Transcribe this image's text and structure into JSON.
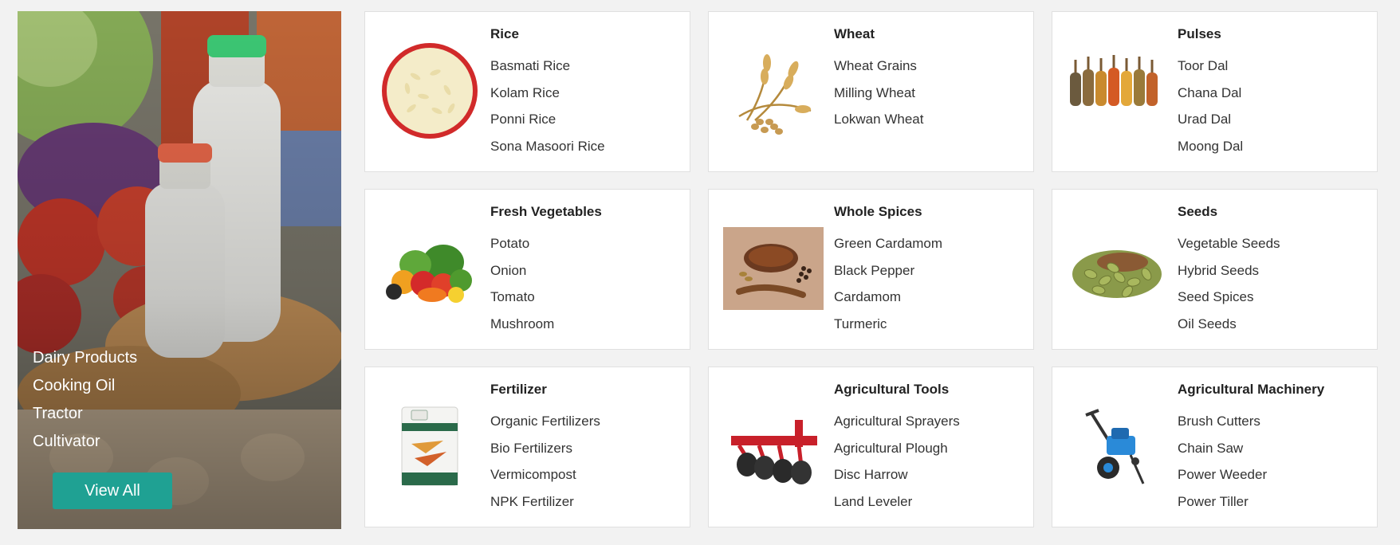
{
  "banner": {
    "items": [
      "Dairy Products",
      "Cooking Oil",
      "Tractor",
      "Cultivator"
    ],
    "button_label": "View All",
    "button_color": "#1fa193"
  },
  "categories": [
    {
      "title": "Rice",
      "icon": "rice-image",
      "items": [
        "Basmati Rice",
        "Kolam Rice",
        "Ponni Rice",
        "Sona Masoori Rice"
      ]
    },
    {
      "title": "Wheat",
      "icon": "wheat-image",
      "items": [
        "Wheat Grains",
        "Milling Wheat",
        "Lokwan Wheat"
      ]
    },
    {
      "title": "Pulses",
      "icon": "pulses-image",
      "items": [
        "Toor Dal",
        "Chana Dal",
        "Urad Dal",
        "Moong Dal"
      ]
    },
    {
      "title": "Fresh Vegetables",
      "icon": "vegetables-image",
      "items": [
        "Potato",
        "Onion",
        "Tomato",
        "Mushroom"
      ]
    },
    {
      "title": "Whole Spices",
      "icon": "spices-image",
      "items": [
        "Green Cardamom",
        "Black Pepper",
        "Cardamom",
        "Turmeric"
      ]
    },
    {
      "title": "Seeds",
      "icon": "seeds-image",
      "items": [
        "Vegetable Seeds",
        "Hybrid Seeds",
        "Seed Spices",
        "Oil Seeds"
      ]
    },
    {
      "title": "Fertilizer",
      "icon": "fertilizer-image",
      "items": [
        "Organic Fertilizers",
        "Bio Fertilizers",
        "Vermicompost",
        "NPK Fertilizer"
      ]
    },
    {
      "title": "Agricultural Tools",
      "icon": "plough-image",
      "items": [
        "Agricultural Sprayers",
        "Agricultural Plough",
        "Disc Harrow",
        "Land Leveler"
      ]
    },
    {
      "title": "Agricultural Machinery",
      "icon": "power-weeder-image",
      "items": [
        "Brush Cutters",
        "Chain Saw",
        "Power Weeder",
        "Power Tiller"
      ]
    }
  ]
}
